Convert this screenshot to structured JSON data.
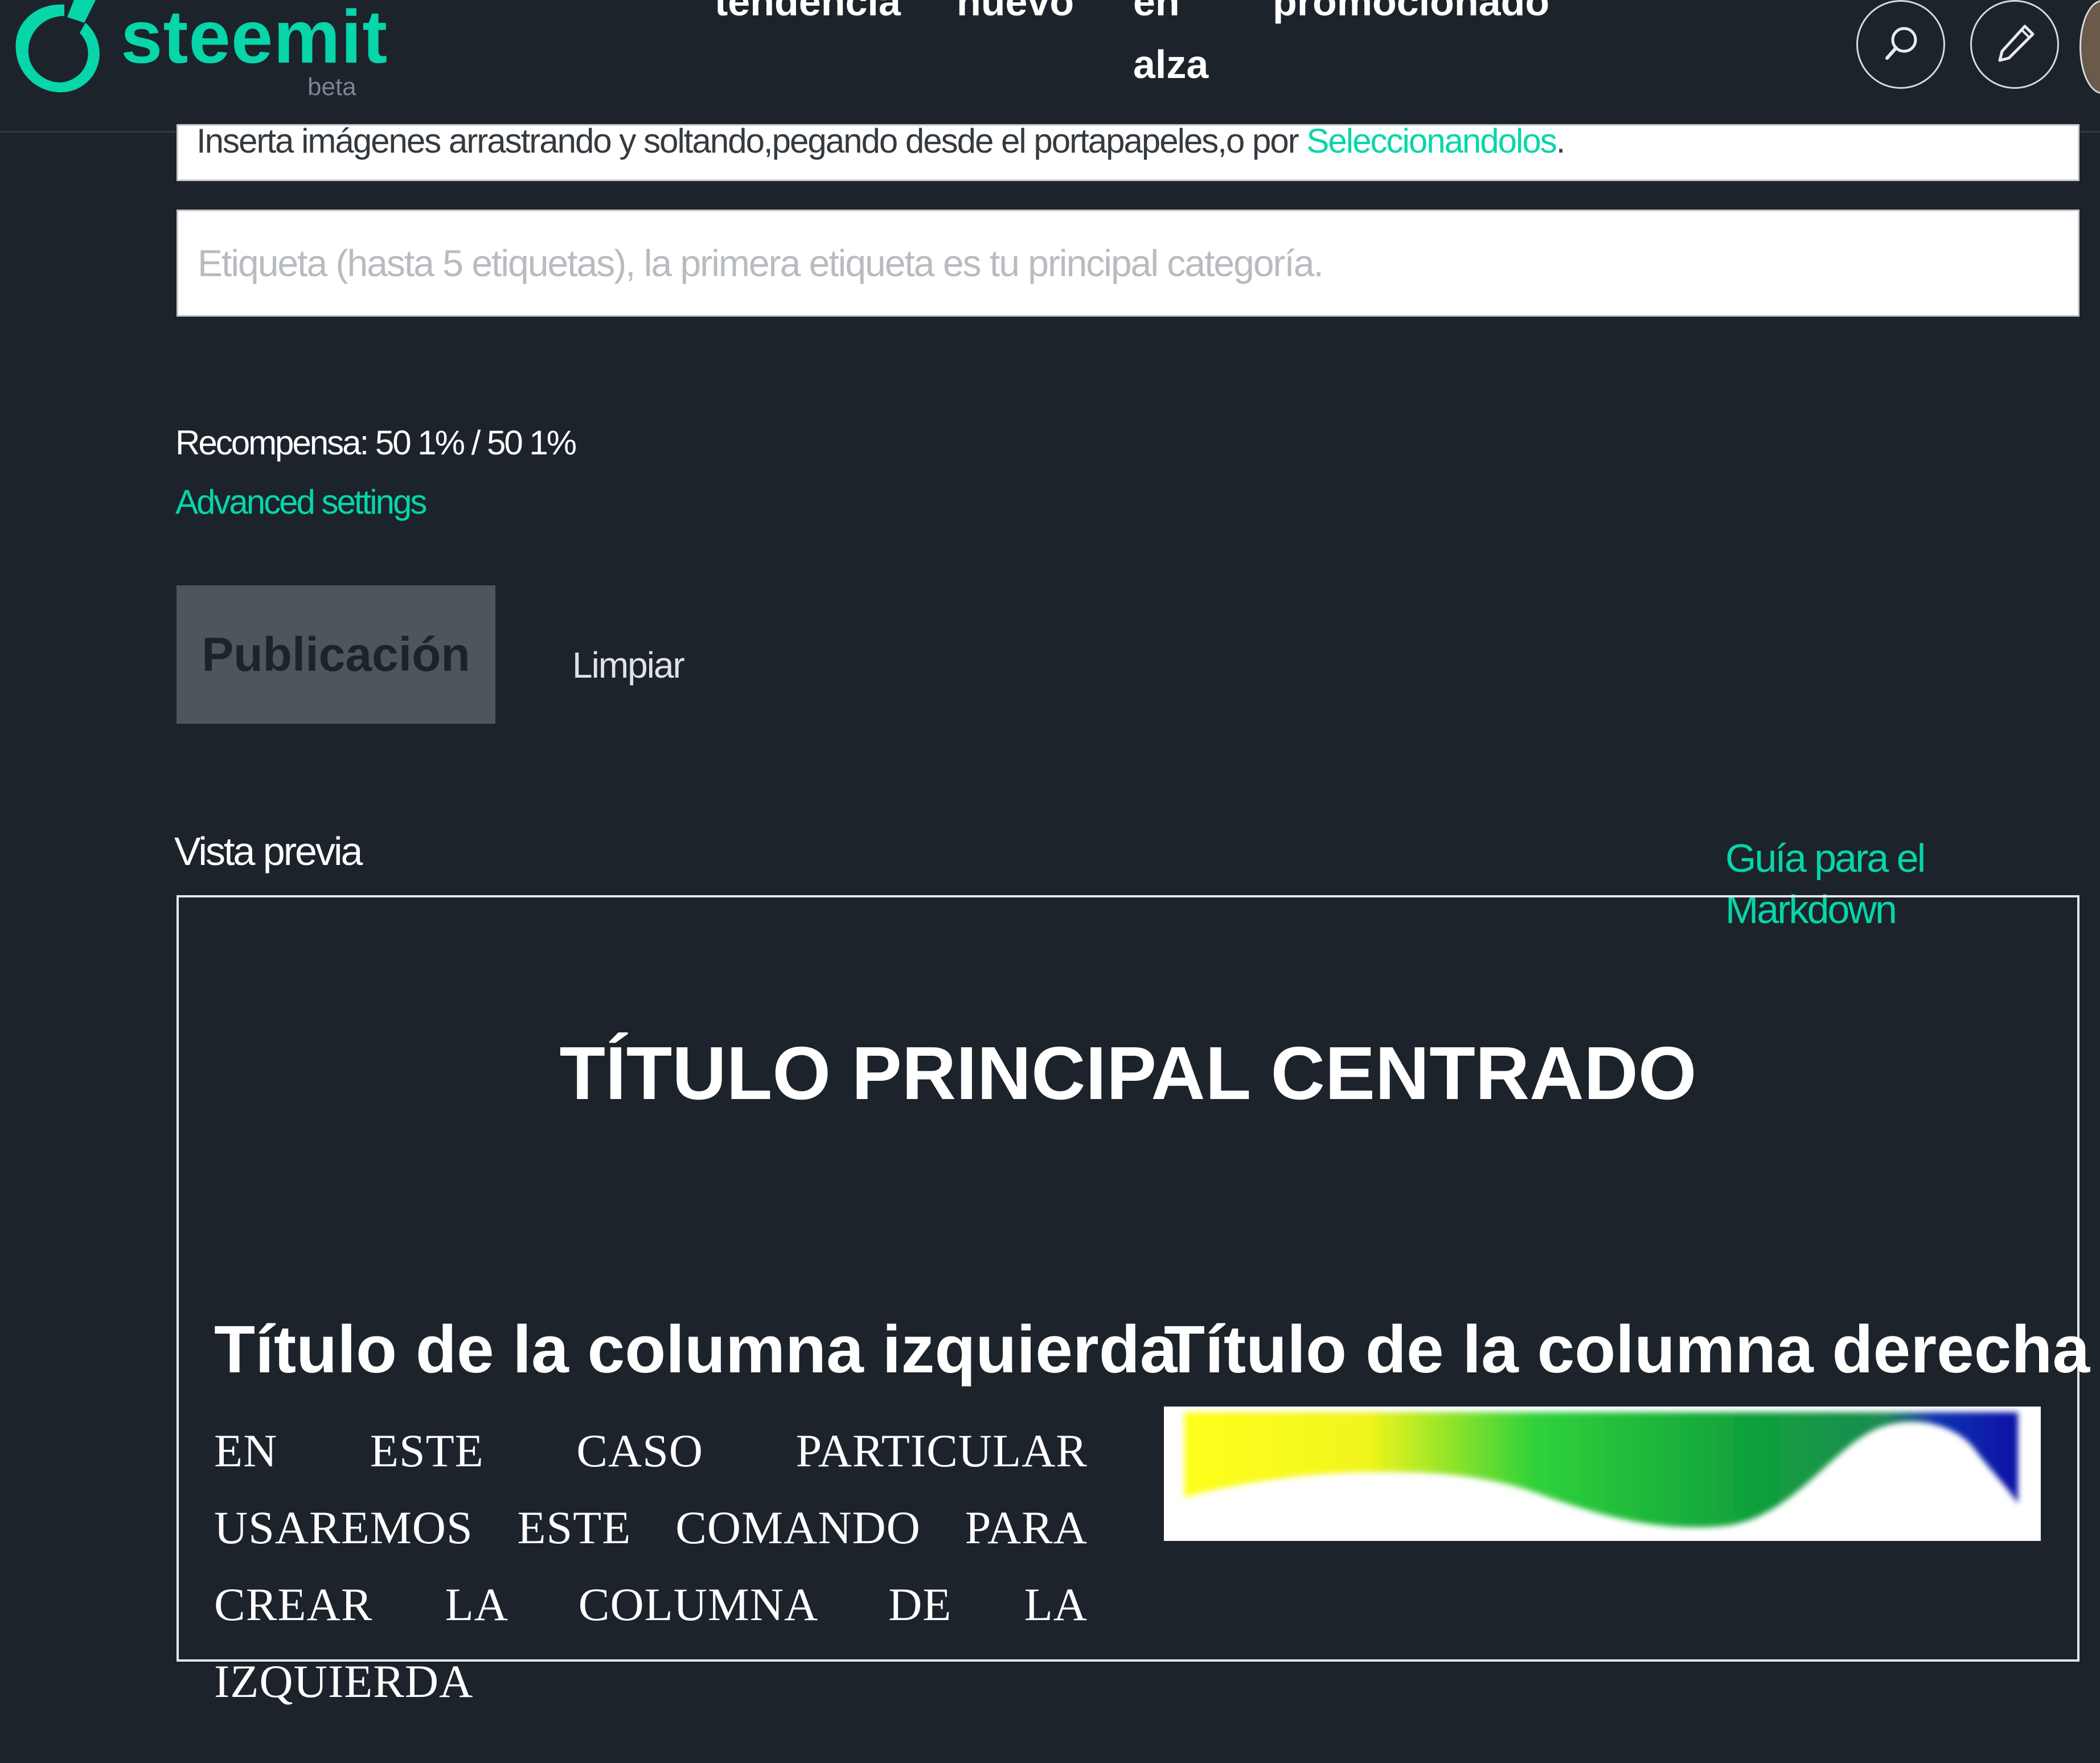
{
  "brand": {
    "name": "steemit",
    "tag": "beta",
    "accent": "#06d6a9"
  },
  "nav": {
    "trending": "tendencia",
    "new": "nuevo",
    "hot_line1": "en",
    "hot_line2": "alza",
    "promoted": "promocionado"
  },
  "header_icons": {
    "search": "search-icon",
    "compose": "pencil-icon"
  },
  "editor": {
    "dropzone_text": "Inserta imágenes arrastrando y soltando,pegando desde el portapapeles,o por ",
    "dropzone_link": "Seleccionandolos",
    "dropzone_end": ".",
    "tags_placeholder": "Etiqueta (hasta 5 etiquetas), la primera etiqueta es tu principal categoría.",
    "reward": "Recompensa: 50 1% / 50 1%",
    "advanced_settings": "Advanced settings",
    "publish": "Publicación",
    "clear": "Limpiar"
  },
  "preview": {
    "label": "Vista previa",
    "markdown_guide": "Guía para el Markdown",
    "main_title": "TÍTULO PRINCIPAL CENTRADO",
    "left_title": "Título de la columna izquierda",
    "left_body": "EN ESTE CASO PARTICULAR USAREMOS ESTE COMANDO PARA CREAR LA COLUMNA DE LA IZQUIERDA",
    "right_title": "Título de la columna derecha"
  },
  "colors": {
    "background": "#1c232b",
    "button": "#4e555c"
  }
}
